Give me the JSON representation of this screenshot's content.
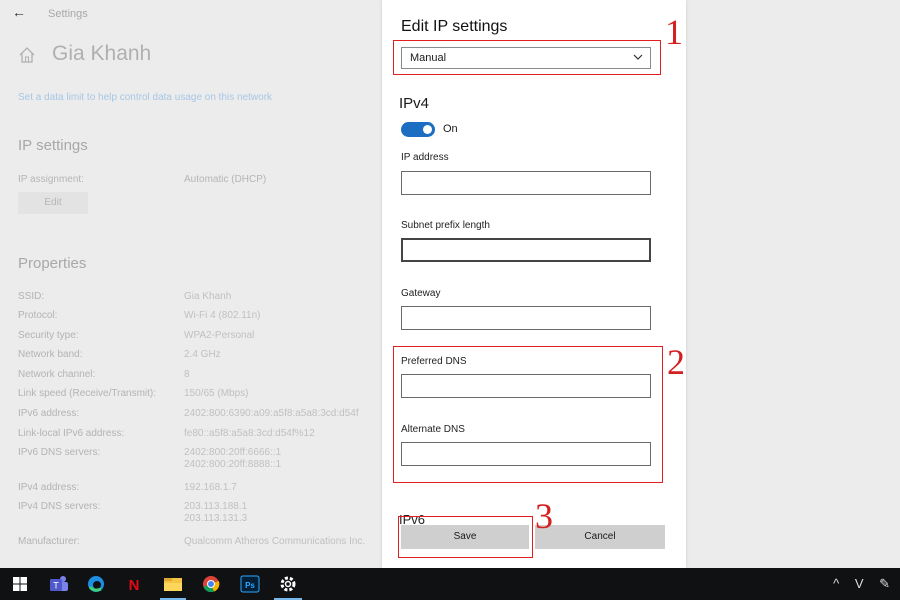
{
  "background": {
    "back_glyph": "←",
    "window_title": "Settings",
    "network_name": "Gia Khanh",
    "data_limit_link": "Set a data limit to help control data usage on this network",
    "ip_settings_title": "IP settings",
    "ip_assignment_label": "IP assignment:",
    "ip_assignment_value": "Automatic (DHCP)",
    "edit_button": "Edit",
    "properties_title": "Properties",
    "properties": [
      {
        "label": "SSID:",
        "value": "Gia Khanh"
      },
      {
        "label": "Protocol:",
        "value": "Wi-Fi 4 (802.11n)"
      },
      {
        "label": "Security type:",
        "value": "WPA2-Personal"
      },
      {
        "label": "Network band:",
        "value": "2.4 GHz"
      },
      {
        "label": "Network channel:",
        "value": "8"
      },
      {
        "label": "Link speed (Receive/Transmit):",
        "value": "150/65 (Mbps)"
      },
      {
        "label": "IPv6 address:",
        "value": "2402:800:6390:a09:a5f8:a5a8:3cd:d54f"
      },
      {
        "label": "Link-local IPv6 address:",
        "value": "fe80::a5f8:a5a8:3cd:d54f%12"
      },
      {
        "label": "IPv6 DNS servers:",
        "value": "2402:800:20ff:6666::1\n2402:800:20ff:8888::1"
      },
      {
        "label": "IPv4 address:",
        "value": "192.168.1.7"
      },
      {
        "label": "IPv4 DNS servers:",
        "value": "203.113.188.1\n203.113.131.3"
      },
      {
        "label": "Manufacturer:",
        "value": "Qualcomm Atheros Communications Inc."
      }
    ]
  },
  "dialog": {
    "title": "Edit IP settings",
    "mode_value": "Manual",
    "ipv4_title": "IPv4",
    "toggle_label": "On",
    "fields": {
      "ip_address": {
        "label": "IP address",
        "value": ""
      },
      "subnet": {
        "label": "Subnet prefix length",
        "value": ""
      },
      "gateway": {
        "label": "Gateway",
        "value": ""
      },
      "preferred_dns": {
        "label": "Preferred DNS",
        "value": ""
      },
      "alternate_dns": {
        "label": "Alternate DNS",
        "value": ""
      }
    },
    "ipv6_title": "IPv6",
    "save_label": "Save",
    "cancel_label": "Cancel"
  },
  "annotations": {
    "one": "1",
    "two": "2",
    "three": "3"
  },
  "taskbar": {
    "icons": [
      "windows-start-icon",
      "teams-icon",
      "edge-icon",
      "netflix-icon",
      "file-explorer-icon",
      "chrome-icon",
      "photoshop-icon",
      "settings-icon"
    ],
    "tray": "^ V ✎"
  },
  "colors": {
    "accent": "#1b6ec2",
    "annotation": "#e02020",
    "taskbar": "#0f1113"
  }
}
